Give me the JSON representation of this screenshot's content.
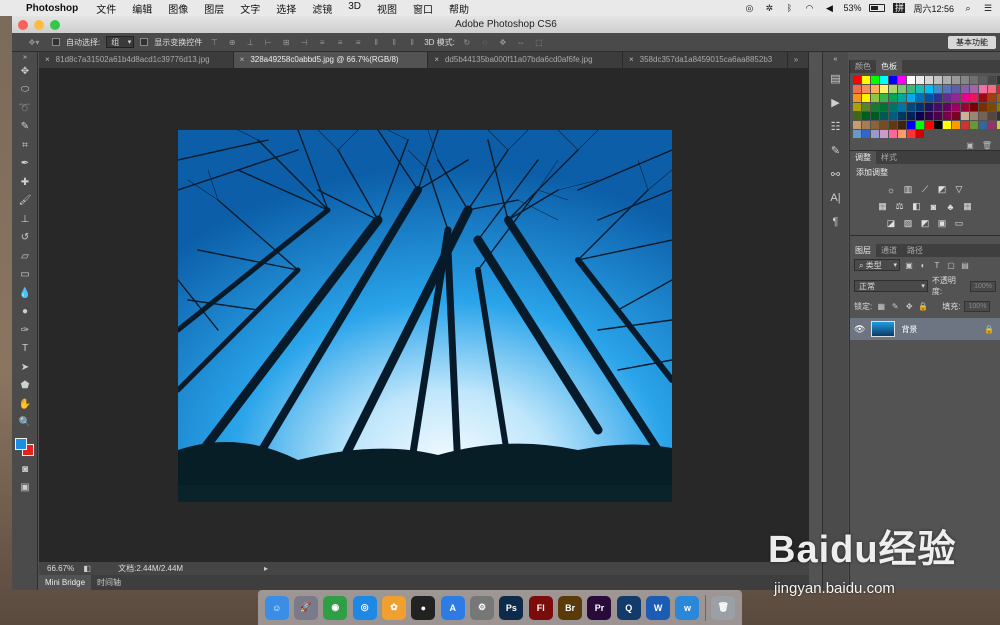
{
  "menubar": {
    "app_name": "Photoshop",
    "items": [
      "文件",
      "编辑",
      "图像",
      "图层",
      "文字",
      "选择",
      "滤镜",
      "3D",
      "视图",
      "窗口",
      "帮助"
    ],
    "battery": "53%",
    "clock": "周六12:56"
  },
  "window": {
    "title": "Adobe Photoshop CS6"
  },
  "options": {
    "auto_select_label": "自动选择:",
    "auto_select_value": "组",
    "show_transform_label": "显示变换控件",
    "mode_3d_label": "3D 模式:",
    "workspace": "基本功能"
  },
  "tabs": [
    {
      "label": "81d8c7a31502a61b4d8acd1c39776d13.jpg",
      "active": false
    },
    {
      "label": "328a49258c0abbd5.jpg @ 66.7%(RGB/8)",
      "active": true
    },
    {
      "label": "dd5b44135ba000f11a07bda6cd0af6fe.jpg",
      "active": false
    },
    {
      "label": "358dc357da1a8459015ca6aa8852b3",
      "active": false
    }
  ],
  "statusbar": {
    "zoom": "66.67%",
    "doc_info": "文档:2.44M/2.44M"
  },
  "bottom_tabs": [
    "Mini Bridge",
    "时间轴"
  ],
  "panels": {
    "color_tabs": [
      "颜色",
      "色板"
    ],
    "adjust_tabs": [
      "调整",
      "样式"
    ],
    "adjust_title": "添加调整",
    "layer_tabs": [
      "图层",
      "通道",
      "路径"
    ],
    "filter_kind": "类型",
    "blend_mode": "正常",
    "opacity_label": "不透明度:",
    "opacity_value": "100%",
    "lock_label": "锁定:",
    "fill_label": "填充:",
    "fill_value": "100%",
    "layer_name": "背景"
  },
  "colors": {
    "foreground": "#1a8fe0",
    "background": "#e8201c"
  },
  "swatch_colors": [
    "#ff0000",
    "#ffff00",
    "#00ff00",
    "#00ffff",
    "#0000ff",
    "#ff00ff",
    "#ffffff",
    "#ebebeb",
    "#d6d6d6",
    "#c2c2c2",
    "#adadad",
    "#999999",
    "#858585",
    "#707070",
    "#5c5c5c",
    "#474747",
    "#333333",
    "#f26c4f",
    "#f68e55",
    "#fbaf5c",
    "#fff467",
    "#acd372",
    "#7cc576",
    "#3bb878",
    "#1abbb4",
    "#00bff3",
    "#438cca",
    "#5574b9",
    "#605ca8",
    "#855fa8",
    "#a763a8",
    "#f06ea9",
    "#f26d7d",
    "#ed1c24",
    "#f7941d",
    "#fff200",
    "#8dc63f",
    "#39b54a",
    "#00a651",
    "#00a99d",
    "#00aeef",
    "#0072bc",
    "#0054a6",
    "#2e3192",
    "#662d91",
    "#92278f",
    "#ec008c",
    "#ed145b",
    "#9e0b0f",
    "#a0410d",
    "#a3620a",
    "#aba000",
    "#598527",
    "#197b30",
    "#007236",
    "#00746b",
    "#0076a3",
    "#004a80",
    "#003471",
    "#1b1464",
    "#440e62",
    "#630460",
    "#9e005d",
    "#9e0039",
    "#790000",
    "#7b2e00",
    "#7d4900",
    "#827b00",
    "#406618",
    "#005e20",
    "#005826",
    "#005952",
    "#005b7f",
    "#003663",
    "#002157",
    "#0d004c",
    "#32004b",
    "#4b0049",
    "#7b0046",
    "#7a0026",
    "#c7b299",
    "#998675",
    "#736357",
    "#534741",
    "#37302d",
    "#c69c6d",
    "#a67c52",
    "#8c6239",
    "#754c24",
    "#603913",
    "#3c2415",
    "#0000ff",
    "#00ff00",
    "#ff0000",
    "#000000",
    "#ffff00",
    "#ff9900",
    "#cc3333",
    "#669933",
    "#336699",
    "#993366",
    "#cccc33",
    "#6699cc",
    "#3366cc",
    "#9999cc",
    "#cc99cc",
    "#ff6699",
    "#ff9966",
    "#ff3333",
    "#cc0000"
  ],
  "dock_apps": [
    {
      "name": "Finder",
      "glyph": "☺",
      "color": "#3a8ee6"
    },
    {
      "name": "Launchpad",
      "glyph": "🚀",
      "color": "#7a7a8a"
    },
    {
      "name": "Chrome",
      "glyph": "◉",
      "color": "#2f9e44"
    },
    {
      "name": "Safari",
      "glyph": "◎",
      "color": "#1e88e5"
    },
    {
      "name": "Photos",
      "glyph": "✿",
      "color": "#f0a030"
    },
    {
      "name": "QQ",
      "glyph": "●",
      "color": "#222222"
    },
    {
      "name": "App Store",
      "glyph": "A",
      "color": "#2d7be3"
    },
    {
      "name": "System Preferences",
      "glyph": "⚙",
      "color": "#777777"
    },
    {
      "name": "Photoshop",
      "glyph": "Ps",
      "color": "#0e2a4a"
    },
    {
      "name": "Flash",
      "glyph": "Fl",
      "color": "#7a0c0c"
    },
    {
      "name": "Bridge",
      "glyph": "Br",
      "color": "#5a3a08"
    },
    {
      "name": "Premiere",
      "glyph": "Pr",
      "color": "#2a0a3a"
    },
    {
      "name": "QuickTime",
      "glyph": "Q",
      "color": "#123a6a"
    },
    {
      "name": "Word",
      "glyph": "W",
      "color": "#1d5cb4"
    },
    {
      "name": "Wunderlist",
      "glyph": "w",
      "color": "#2b88d8"
    },
    {
      "name": "Trash",
      "glyph": "🗑",
      "color": "#9aa0a6"
    }
  ],
  "watermark": {
    "logo_text": "Baidu经验",
    "url": "jingyan.baidu.com"
  }
}
